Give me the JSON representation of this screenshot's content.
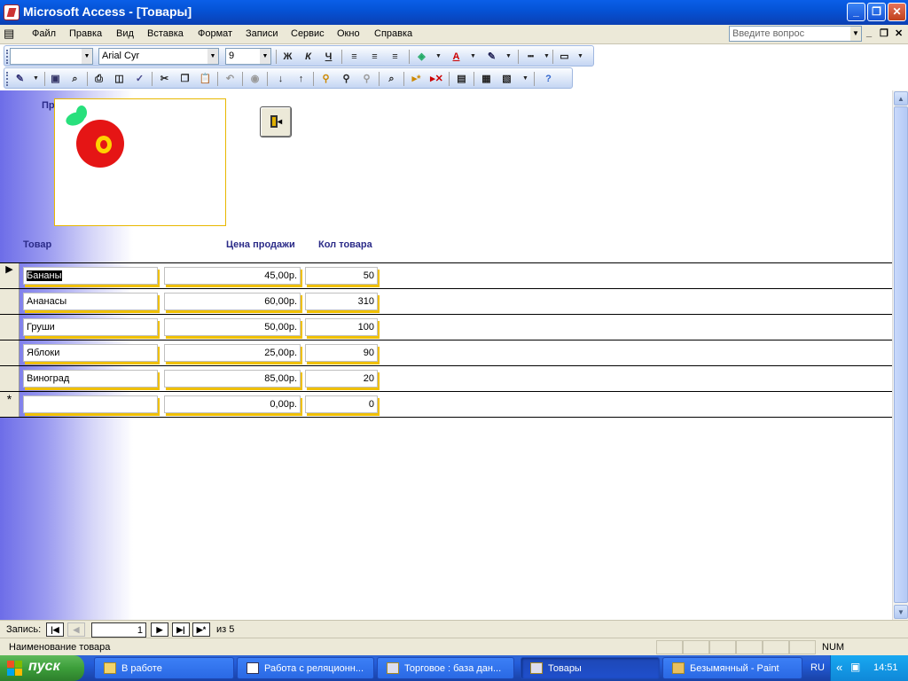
{
  "window": {
    "title": "Microsoft Access - [Товары]"
  },
  "menu": {
    "items": [
      "Файл",
      "Правка",
      "Вид",
      "Вставка",
      "Формат",
      "Записи",
      "Сервис",
      "Окно",
      "Справка"
    ],
    "help_placeholder": "Введите вопрос"
  },
  "format_toolbar": {
    "object_combo": "",
    "font_name": "Arial Cyr",
    "font_size": "9",
    "bold": "Ж",
    "italic": "К",
    "underline": "Ч"
  },
  "form": {
    "picture_label": "Пр",
    "headers": {
      "product": "Товар",
      "price": "Цена продажи",
      "qty": "Кол товара"
    },
    "rows": [
      {
        "product": "Бананы",
        "price": "45,00р.",
        "qty": "50"
      },
      {
        "product": "Ананасы",
        "price": "60,00р.",
        "qty": "310"
      },
      {
        "product": "Груши",
        "price": "50,00р.",
        "qty": "100"
      },
      {
        "product": "Яблоки",
        "price": "25,00р.",
        "qty": "90"
      },
      {
        "product": "Виноград",
        "price": "85,00р.",
        "qty": "20"
      }
    ],
    "new_row": {
      "product": "",
      "price": "0,00р.",
      "qty": "0"
    },
    "new_row_marker": "*",
    "current_row_marker": "▶"
  },
  "navigation": {
    "label": "Запись:",
    "current": "1",
    "of_text": "из 5"
  },
  "status": {
    "text": "Наименование товара",
    "num": "NUM"
  },
  "taskbar": {
    "start": "пуск",
    "tasks": [
      "В работе",
      "Работа с реляционн...",
      "Торговое : база дан...",
      "Товары",
      "Безымянный - Paint"
    ],
    "lang": "RU",
    "clock": "14:51"
  }
}
